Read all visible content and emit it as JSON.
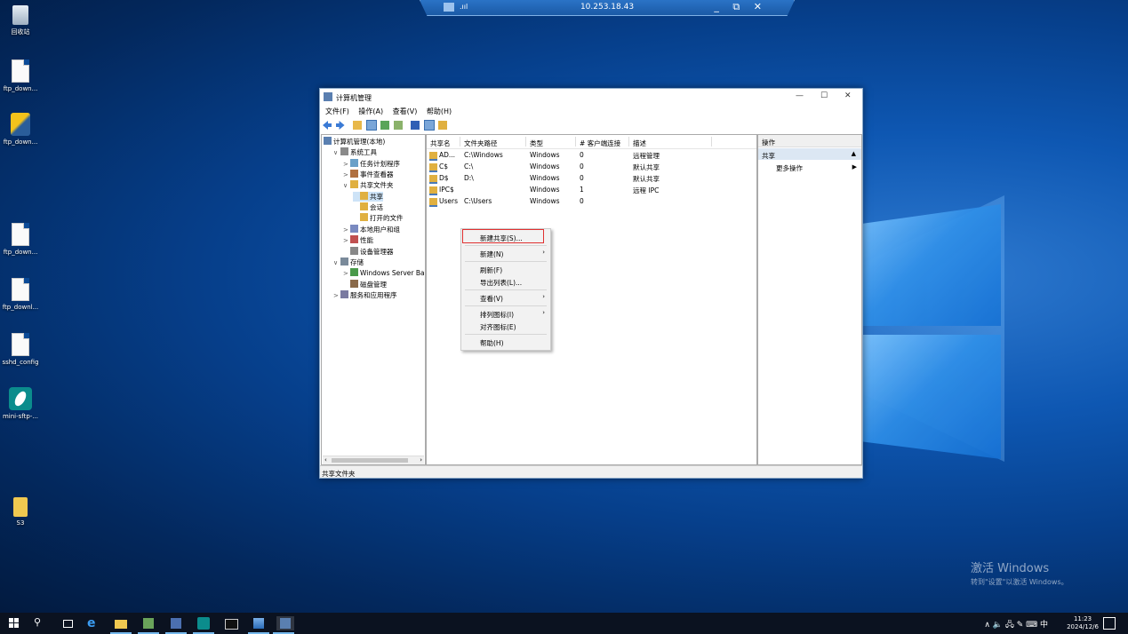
{
  "remote_bar": {
    "ip": "10.253.18.43",
    "signal": ".ııl",
    "controls": "_ ⧉ ✕"
  },
  "desktop_icons": [
    {
      "label": "回收站",
      "kind": "recycle"
    },
    {
      "label": "ftp_down...",
      "kind": "file"
    },
    {
      "label": "ftp_down...",
      "kind": "python"
    },
    {
      "label": "ftp_down...",
      "kind": "file"
    },
    {
      "label": "ftp_downl...",
      "kind": "file"
    },
    {
      "label": "sshd_config",
      "kind": "file"
    },
    {
      "label": "mini-sftp-...",
      "kind": "app"
    },
    {
      "label": "S3",
      "kind": "folder"
    }
  ],
  "watermark": {
    "line1": "激活 Windows",
    "line2": "转到\"设置\"以激活 Windows。"
  },
  "window": {
    "title": "计算机管理",
    "controls": {
      "minimize": "—",
      "maximize": "☐",
      "close": "✕"
    },
    "menu": [
      "文件(F)",
      "操作(A)",
      "查看(V)",
      "帮助(H)"
    ],
    "tree": [
      {
        "label": "计算机管理(本地)",
        "indent": 0,
        "expander": ""
      },
      {
        "label": "系统工具",
        "indent": 1,
        "expander": "∨"
      },
      {
        "label": "任务计划程序",
        "indent": 2,
        "expander": ">"
      },
      {
        "label": "事件查看器",
        "indent": 2,
        "expander": ">"
      },
      {
        "label": "共享文件夹",
        "indent": 2,
        "expander": "∨"
      },
      {
        "label": "共享",
        "indent": 3,
        "expander": "",
        "selected": true
      },
      {
        "label": "会话",
        "indent": 3,
        "expander": ""
      },
      {
        "label": "打开的文件",
        "indent": 3,
        "expander": ""
      },
      {
        "label": "本地用户和组",
        "indent": 2,
        "expander": ">"
      },
      {
        "label": "性能",
        "indent": 2,
        "expander": ">"
      },
      {
        "label": "设备管理器",
        "indent": 2,
        "expander": ""
      },
      {
        "label": "存储",
        "indent": 1,
        "expander": "∨"
      },
      {
        "label": "Windows Server Back",
        "indent": 2,
        "expander": ">"
      },
      {
        "label": "磁盘管理",
        "indent": 2,
        "expander": ""
      },
      {
        "label": "服务和应用程序",
        "indent": 1,
        "expander": ">"
      }
    ],
    "columns": [
      "共享名",
      "文件夹路径",
      "类型",
      "# 客户端连接",
      "描述"
    ],
    "rows": [
      {
        "name": "AD...",
        "path": "C:\\Windows",
        "type": "Windows",
        "clients": "0",
        "desc": "远程管理"
      },
      {
        "name": "C$",
        "path": "C:\\",
        "type": "Windows",
        "clients": "0",
        "desc": "默认共享"
      },
      {
        "name": "D$",
        "path": "D:\\",
        "type": "Windows",
        "clients": "0",
        "desc": "默认共享"
      },
      {
        "name": "IPC$",
        "path": "",
        "type": "Windows",
        "clients": "1",
        "desc": "远程 IPC"
      },
      {
        "name": "Users",
        "path": "C:\\Users",
        "type": "Windows",
        "clients": "0",
        "desc": ""
      }
    ],
    "actions": {
      "header": "操作",
      "section": "共享",
      "more": "更多操作"
    },
    "status": "共享文件夹"
  },
  "context_menu": [
    {
      "label": "新建共享(S)...",
      "arrow": "",
      "highlight": true
    },
    {
      "label": "新建(N)",
      "arrow": "›"
    },
    {
      "label": "刷新(F)",
      "arrow": ""
    },
    {
      "label": "导出列表(L)...",
      "arrow": ""
    },
    {
      "label": "查看(V)",
      "arrow": "›"
    },
    {
      "label": "排列图标(I)",
      "arrow": "›"
    },
    {
      "label": "对齐图标(E)",
      "arrow": ""
    },
    {
      "label": "帮助(H)",
      "arrow": ""
    }
  ],
  "taskbar": {
    "time": "11:23",
    "date": "2024/12/6",
    "tray": "∧ 🔈 🖧 ✎ ⌨ 中",
    "icons": [
      "start-icon",
      "search-icon",
      "task-view-icon",
      "ie-icon",
      "file-explorer-icon",
      "app-icon",
      "server-manager-icon",
      "mini-sftp-icon",
      "terminal-icon",
      "chart-app-icon",
      "computer-management-icon"
    ]
  }
}
